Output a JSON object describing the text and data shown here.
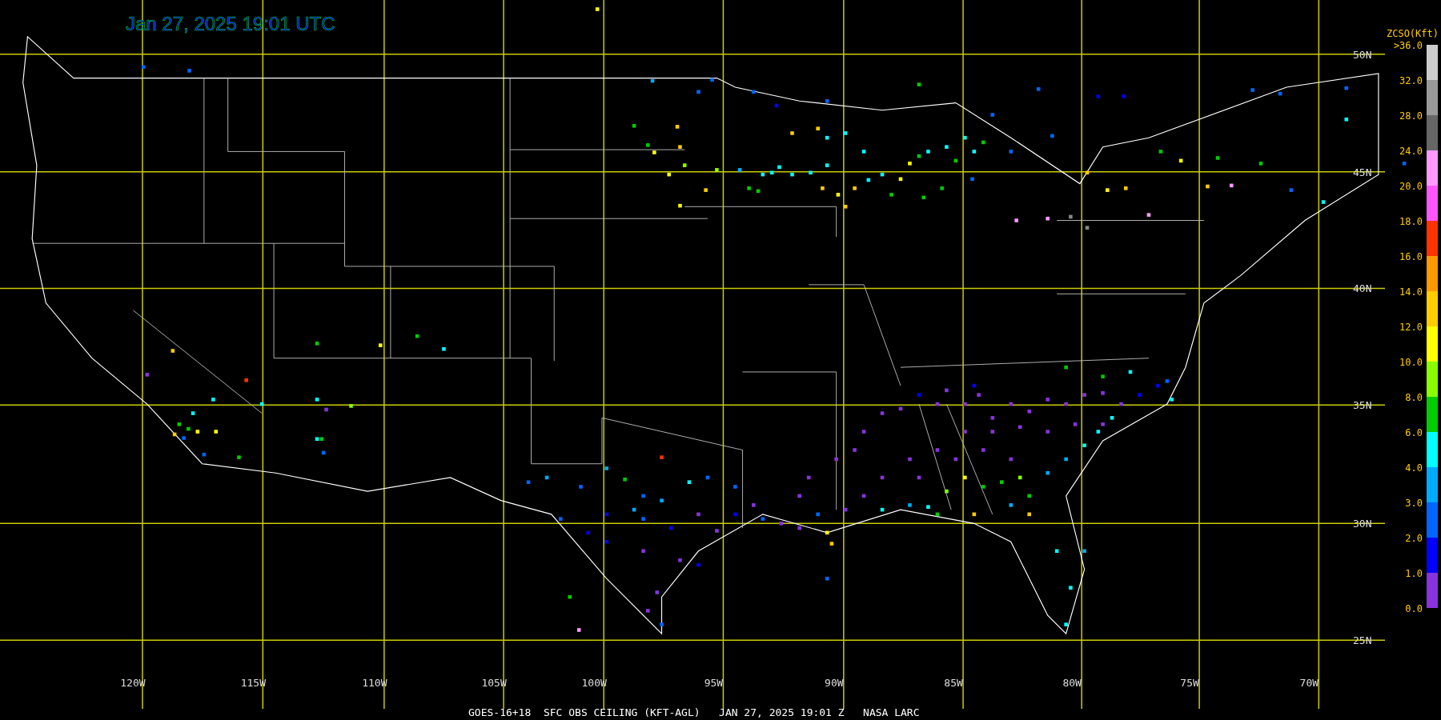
{
  "title": "Jan 27, 2025 19:01 UTC",
  "latitude_labels": [
    "50N",
    "45N",
    "40N",
    "35N",
    "30N",
    "25N"
  ],
  "longitude_labels": [
    "120W",
    "115W",
    "110W",
    "105W",
    "100W",
    "95W",
    "90W",
    "85W",
    "80W",
    "75W",
    "70W"
  ],
  "legend": {
    "title": "ZCSO(Kft)",
    "labels": [
      ">36.0",
      "32.0",
      "28.0",
      "24.0",
      "20.0",
      "18.0",
      "16.0",
      "14.0",
      "12.0",
      "10.0",
      "8.0",
      "6.0",
      "4.0",
      "3.0",
      "2.0",
      "1.0",
      "0.0"
    ],
    "segments": [
      {
        "color": "#cccccc"
      },
      {
        "color": "#999999"
      },
      {
        "color": "#666666"
      },
      {
        "color": "#ff99ff"
      },
      {
        "color": "#ff55ff"
      },
      {
        "color": "#ff3300"
      },
      {
        "color": "#ff9900"
      },
      {
        "color": "#ffcc00"
      },
      {
        "color": "#ffff00"
      },
      {
        "color": "#88ff00"
      },
      {
        "color": "#00cc00"
      },
      {
        "color": "#00ffff"
      },
      {
        "color": "#00aaff"
      },
      {
        "color": "#0066ff"
      },
      {
        "color": "#0000ff"
      },
      {
        "color": "#8833dd"
      }
    ]
  },
  "caption": "GOES-16+18  SFC OBS CEILING (KFT-AGL)   JAN 27, 2025 19:01 Z   NASA LARC"
}
